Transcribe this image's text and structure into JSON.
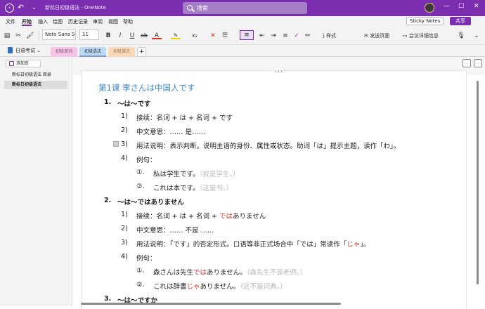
{
  "titlebar": {
    "title": "新标日初级语法 - OneNote",
    "search_placeholder": "搜索"
  },
  "menu": {
    "items": [
      "文件",
      "开始",
      "插入",
      "绘图",
      "历史记录",
      "审阅",
      "视图",
      "帮助"
    ],
    "active": "开始",
    "sticky_notes": "Sticky Notes",
    "share": "共享"
  },
  "ribbon": {
    "font_name": "Noto Sans SC",
    "font_size": "11",
    "styles_label": "样式",
    "send_page": "发送页面",
    "meeting_details": "会议详细信息"
  },
  "notebook": {
    "name": "日语考试",
    "sections": [
      "初级单词",
      "初级语法",
      "初级课文"
    ],
    "active_section": "初级语法",
    "add_section": "+"
  },
  "sidebar": {
    "add_page": "添加页",
    "pages": [
      "新标日初级语法 目录",
      "新标日初级语法"
    ],
    "selected_page": "新标日初级语法"
  },
  "page": {
    "title": "第1课 李さんは中国人です",
    "items": [
      {
        "num": "1.",
        "heading": "〜は〜です",
        "sub": [
          {
            "num": "1)",
            "text": "接续：名词 + は + 名词 + です"
          },
          {
            "num": "2)",
            "text": "中文意思：…… 是……"
          },
          {
            "num": "3)",
            "text": "用法说明：表示判断，说明主语的身份、属性或状态。助词「は」提示主题，读作「わ」。"
          },
          {
            "num": "4)",
            "text": "例句："
          }
        ],
        "examples": [
          {
            "num": "①.",
            "jp": "私は学生です。",
            "cn": "（我是学生。）"
          },
          {
            "num": "②.",
            "jp": "これは本です。",
            "cn": "（这是书。）"
          }
        ]
      },
      {
        "num": "2.",
        "heading": "〜は〜ではありません",
        "sub": [
          {
            "num": "1)",
            "text_pre": "接续：名词 + は + 名词 + ",
            "red": "では",
            "text_post": "ありません"
          },
          {
            "num": "2)",
            "text": "中文意思：…… 不是 ……"
          },
          {
            "num": "3)",
            "text_pre": "用法说明：「です」的否定形式。口语等非正式场合中「では」常读作「",
            "red": "じゃ",
            "text_post": "」。"
          },
          {
            "num": "4)",
            "text": "例句："
          }
        ],
        "examples": [
          {
            "num": "①.",
            "jp_pre": "森さんは先生",
            "red": "では",
            "jp_post": "ありません。",
            "cn": "（森先生不是老师。）"
          },
          {
            "num": "②.",
            "jp_pre": "これは辞書",
            "red": "じゃ",
            "jp_post": "ありません。",
            "cn": "（这不是词典。）"
          }
        ]
      },
      {
        "num": "3.",
        "heading": "〜は〜ですか"
      }
    ]
  },
  "colors": {
    "titlebar": "#7b2fb0",
    "title_text": "#3d88c9",
    "emphasis_red": "#d93025",
    "translation_gray": "#b8b8b8"
  }
}
